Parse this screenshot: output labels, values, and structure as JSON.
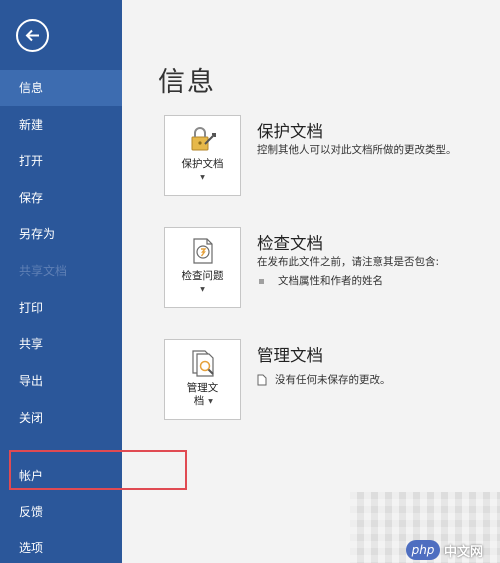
{
  "sidebar": {
    "back_icon": "back-arrow-icon",
    "items": [
      {
        "label": "信息",
        "state": "active"
      },
      {
        "label": "新建",
        "state": "normal"
      },
      {
        "label": "打开",
        "state": "normal"
      },
      {
        "label": "保存",
        "state": "normal"
      },
      {
        "label": "另存为",
        "state": "normal"
      },
      {
        "label": "共享",
        "state": "normal"
      },
      {
        "label": "打印",
        "state": "normal"
      },
      {
        "label": "共享",
        "state": "normal"
      },
      {
        "label": "导出",
        "state": "normal"
      },
      {
        "label": "关闭",
        "state": "normal"
      },
      {
        "label": "帐户",
        "state": "normal"
      },
      {
        "label": "反馈",
        "state": "normal"
      },
      {
        "label": "选项",
        "state": "normal"
      }
    ],
    "faded_item": "共享文档"
  },
  "main": {
    "title": "信息",
    "sections": [
      {
        "title": "保护文档",
        "button_label": "保护文档",
        "icon": "lock-key-icon",
        "description": "控制其他人可以对此文档所做的更改类型。"
      },
      {
        "title": "检查文档",
        "button_label": "检查问题",
        "icon": "inspect-document-icon",
        "description": "在发布此文件之前，请注意其是否包含:",
        "bullets": [
          "文档属性和作者的姓名"
        ]
      },
      {
        "title": "管理文档",
        "button_label_line1": "管理文",
        "button_label_line2": "档",
        "icon": "manage-document-icon",
        "status": "没有任何未保存的更改。"
      }
    ]
  },
  "colors": {
    "sidebar": "#2b579a",
    "sidebar_active": "#3d6cb0",
    "background": "#f3f3f3",
    "highlight": "#e04a52"
  },
  "watermark": {
    "badge": "php",
    "text": "中文网"
  }
}
